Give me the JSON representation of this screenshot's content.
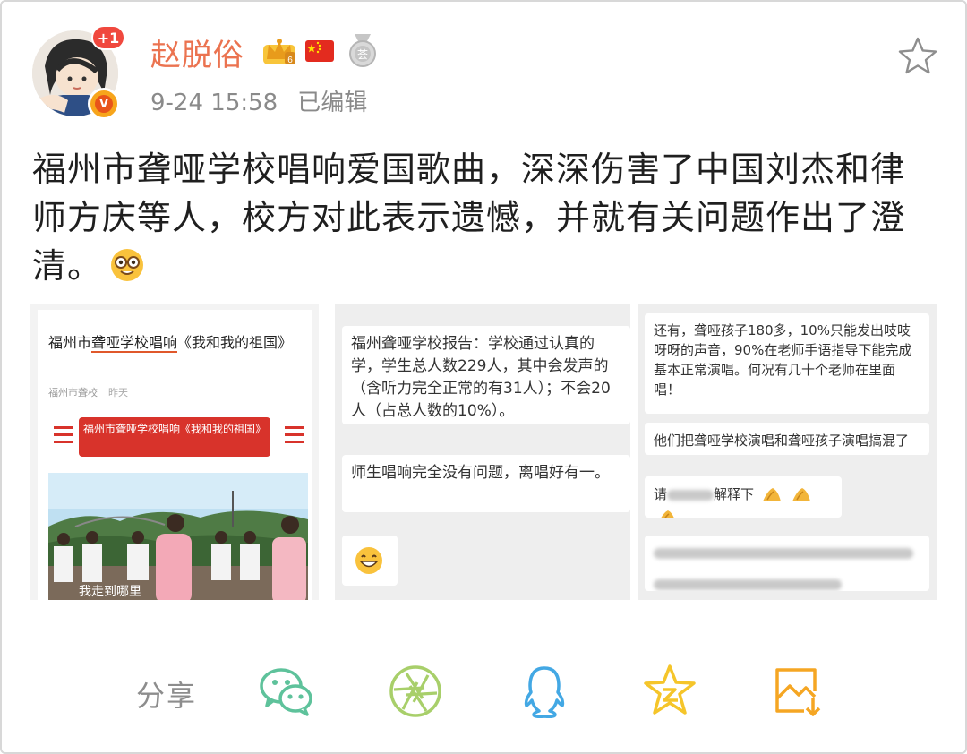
{
  "post": {
    "username": "赵脱俗",
    "avatar_badge": "+1",
    "timestamp": "9-24 15:58",
    "edited_label": "已编辑",
    "text": "福州市聋哑学校唱响爱国歌曲，深深伤害了中国刘杰和律师方庆等人，校方对此表示遗憾，并就有关问题作出了澄清。"
  },
  "images": {
    "article": {
      "title_prefix": "福州市",
      "title_underlined": "聋哑学校唱响",
      "title_suffix": "《我和我的祖国》",
      "source": "福州市聋校",
      "time": "昨天",
      "banner": "福州市聋哑学校唱响《我和我的祖国》",
      "video_subtitle": "我走到哪里"
    },
    "chat_middle": {
      "message1": "福州聋哑学校报告：学校通过认真的学，学生总人数229人，其中会发声的（含听力完全正常的有31人）；不会20人（占总人数的10%）。",
      "message2": "师生唱响完全没有问题，离唱好有一。"
    },
    "chat_right": {
      "message1": "还有，聋哑孩子180多，10%只能发出吱吱呀呀的声音，90%在老师手语指导下能完成基本正常演唱。何况有几十个老师在里面唱！",
      "message2": "他们把聋哑学校演唱和聋哑孩子演唱搞混了",
      "message3_prefix": "请",
      "message3_suffix": "解释下"
    }
  },
  "share": {
    "label": "分享"
  },
  "icons": {
    "star": "star-outline-icon",
    "crown": "crown-vip-icon",
    "flag": "china-flag-icon",
    "medal": "medal-icon",
    "wechat": "wechat-icon",
    "moments": "moments-icon",
    "qq": "qq-icon",
    "qzone": "qzone-icon",
    "save": "save-image-icon"
  },
  "colors": {
    "username": "#eb7350",
    "meta": "#8a8a8a",
    "wechat": "#5ec29b",
    "moments": "#a8cf6a",
    "qq": "#43a8e4",
    "qzone": "#f5c52a",
    "save": "#f5a623"
  }
}
